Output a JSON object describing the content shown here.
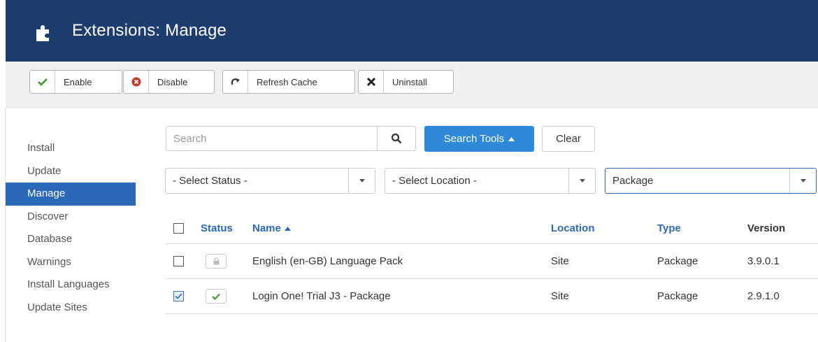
{
  "header": {
    "title": "Extensions: Manage",
    "icon": "puzzle-icon"
  },
  "toolbar": {
    "enable_label": "Enable",
    "disable_label": "Disable",
    "refresh_label": "Refresh Cache",
    "uninstall_label": "Uninstall"
  },
  "sidebar": {
    "items": [
      {
        "label": "Install",
        "active": false
      },
      {
        "label": "Update",
        "active": false
      },
      {
        "label": "Manage",
        "active": true
      },
      {
        "label": "Discover",
        "active": false
      },
      {
        "label": "Database",
        "active": false
      },
      {
        "label": "Warnings",
        "active": false
      },
      {
        "label": "Install Languages",
        "active": false
      },
      {
        "label": "Update Sites",
        "active": false
      }
    ]
  },
  "filters": {
    "search_placeholder": "Search",
    "search_value": "",
    "search_tools_label": "Search Tools",
    "clear_label": "Clear",
    "status_select": "- Select Status -",
    "location_select": "- Select Location -",
    "type_select": "Package"
  },
  "table": {
    "headers": {
      "status": "Status",
      "name": "Name",
      "location": "Location",
      "type": "Type",
      "version": "Version"
    },
    "rows": [
      {
        "checked": false,
        "status": "locked",
        "name": "English (en-GB) Language Pack",
        "location": "Site",
        "type": "Package",
        "version": "3.9.0.1"
      },
      {
        "checked": true,
        "status": "enabled",
        "name": "Login One! Trial J3 - Package",
        "location": "Site",
        "type": "Package",
        "version": "2.9.1.0"
      }
    ]
  },
  "colors": {
    "header_bg": "#1c3d6e",
    "active_nav": "#2a69b8",
    "primary_button": "#2e8ad8",
    "link": "#2a69b8",
    "success": "#4a9a3a",
    "danger": "#c0392b"
  }
}
